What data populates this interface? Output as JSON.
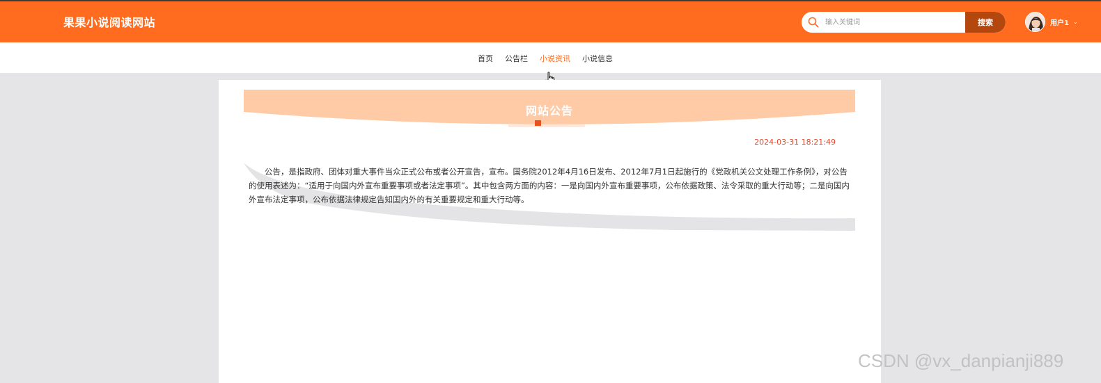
{
  "header": {
    "site_title": "果果小说阅读网站",
    "search": {
      "placeholder": "输入关键词",
      "button_label": "搜索"
    },
    "user": {
      "name": "用户1",
      "caret": "⌄"
    }
  },
  "nav": {
    "items": [
      {
        "label": "首页",
        "active": false
      },
      {
        "label": "公告栏",
        "active": false
      },
      {
        "label": "小说资讯",
        "active": true
      },
      {
        "label": "小说信息",
        "active": false
      }
    ]
  },
  "announcement": {
    "title": "网站公告",
    "date": "2024-03-31 18:21:49",
    "body": "公告，是指政府、团体对重大事件当众正式公布或者公开宣告，宣布。国务院2012年4月16日发布、2012年7月1日起施行的《党政机关公文处理工作条例》，对公告的使用表述为：“适用于向国内外宣布重要事项或者法定事项”。其中包含两方面的内容：一是向国内外宣布重要事项，公布依据政策、法令采取的重大行动等；二是向国内外宣布法定事项，公布依据法律规定告知国内外的有关重要规定和重大行动等。"
  },
  "watermark": "CSDN @vx_danpianji889",
  "colors": {
    "brand": "#ff6b1f",
    "search_button": "#b3470e",
    "banner": "#ffcba7",
    "date": "#e6472b",
    "background": "#e5e5e7"
  }
}
